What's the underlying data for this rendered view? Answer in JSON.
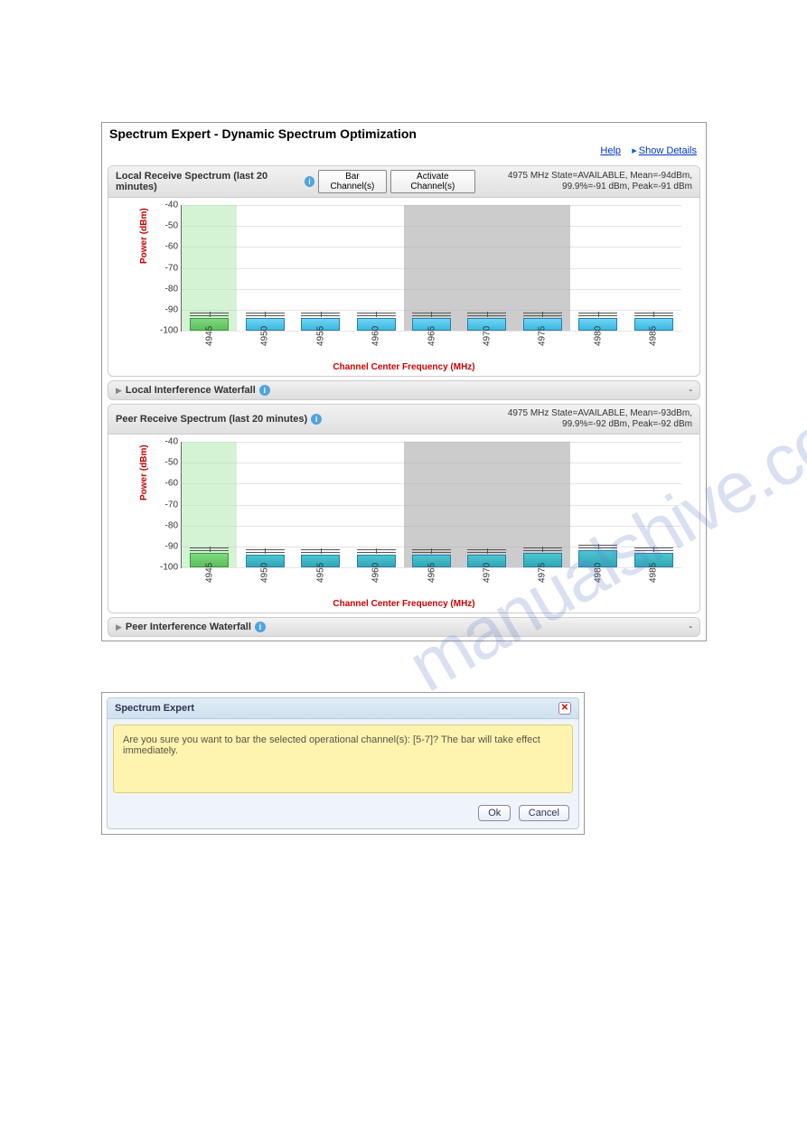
{
  "header": {
    "title": "Spectrum Expert - Dynamic Spectrum Optimization",
    "help_label": "Help",
    "show_details_label": "Show Details"
  },
  "local_spectrum": {
    "title": "Local Receive Spectrum (last 20 minutes)",
    "bar_btn": "Bar Channel(s)",
    "activate_btn": "Activate Channel(s)",
    "status": "4975 MHz State=AVAILABLE, Mean=-94dBm, 99.9%=-91 dBm, Peak=-91 dBm"
  },
  "local_waterfall": {
    "title": "Local Interference Waterfall"
  },
  "peer_spectrum": {
    "title": "Peer Receive Spectrum (last 20 minutes)",
    "status": "4975 MHz State=AVAILABLE, Mean=-93dBm, 99.9%=-92 dBm, Peak=-92 dBm"
  },
  "peer_waterfall": {
    "title": "Peer Interference Waterfall"
  },
  "axes": {
    "ylabel": "Power (dBm)",
    "xlabel": "Channel Center Frequency (MHz)"
  },
  "chart_data": [
    {
      "type": "bar",
      "title": "Local Receive Spectrum",
      "ylabel": "Power (dBm)",
      "xlabel": "Channel Center Frequency (MHz)",
      "ylim": [
        -100,
        -40
      ],
      "yticks": [
        -40,
        -50,
        -60,
        -70,
        -80,
        -90,
        -100
      ],
      "categories": [
        "4945",
        "4950",
        "4955",
        "4960",
        "4965",
        "4970",
        "4975",
        "4980",
        "4985"
      ],
      "values": [
        -94,
        -94,
        -94,
        -94,
        -94,
        -94,
        -94,
        -94,
        -94
      ],
      "peaks": [
        -92,
        -92,
        -92,
        -92,
        -92,
        -92,
        -92,
        -92,
        -92
      ],
      "highlight_green_index": 0,
      "shaded_gray_indices": [
        4,
        5,
        6
      ]
    },
    {
      "type": "bar",
      "title": "Peer Receive Spectrum",
      "ylabel": "Power (dBm)",
      "xlabel": "Channel Center Frequency (MHz)",
      "ylim": [
        -100,
        -40
      ],
      "yticks": [
        -40,
        -50,
        -60,
        -70,
        -80,
        -90,
        -100
      ],
      "categories": [
        "4945",
        "4950",
        "4955",
        "4960",
        "4965",
        "4970",
        "4975",
        "4980",
        "4985"
      ],
      "values": [
        -93,
        -94,
        -94,
        -94,
        -94,
        -94,
        -93,
        -92,
        -93
      ],
      "peaks": [
        -91,
        -92,
        -92,
        -92,
        -92,
        -92,
        -91,
        -90,
        -91
      ],
      "highlight_green_index": 0,
      "shaded_gray_indices": [
        4,
        5,
        6
      ]
    }
  ],
  "dialog": {
    "title": "Spectrum Expert",
    "message": "Are you sure you want to bar the selected operational channel(s): [5-7]? The bar will take effect immediately.",
    "ok": "Ok",
    "cancel": "Cancel"
  },
  "watermark": "manualshive.com"
}
